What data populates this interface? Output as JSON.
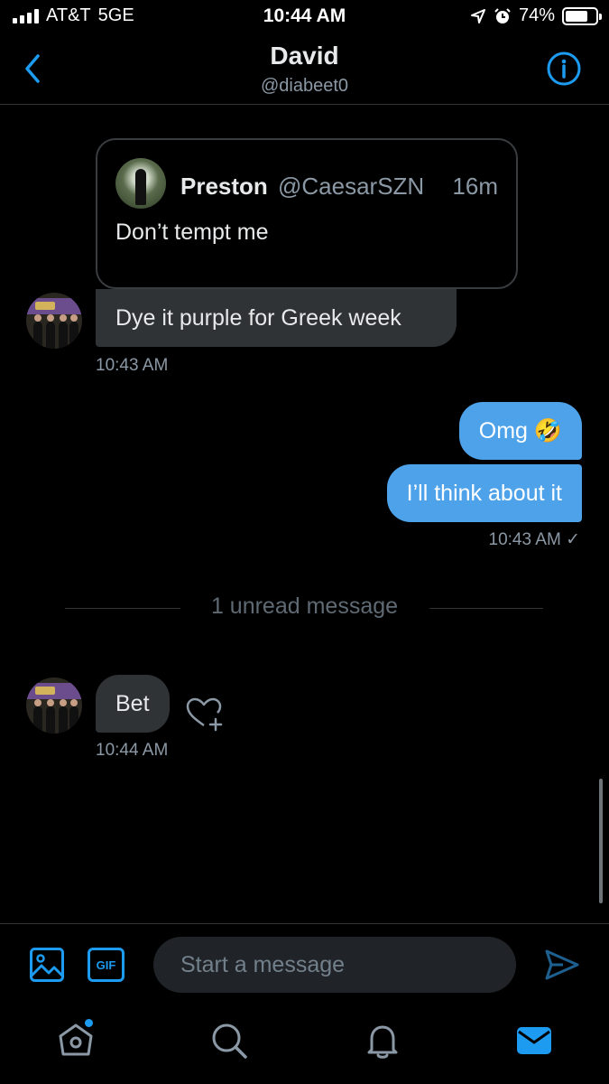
{
  "status_bar": {
    "carrier": "AT&T",
    "network": "5GE",
    "time": "10:44 AM",
    "battery": "74%",
    "battery_level": 0.74
  },
  "header": {
    "name": "David",
    "handle": "@diabeet0",
    "back_icon": "chevron-left-icon",
    "info_icon": "info-icon"
  },
  "quoted_tweet": {
    "name": "Preston",
    "handle": "@CaesarSZN",
    "time": "16m",
    "text": "Don’t tempt me"
  },
  "messages": [
    {
      "direction": "incoming",
      "text": "Dye it purple for Greek week",
      "timestamp": "10:43 AM"
    },
    {
      "direction": "outgoing",
      "text": "Omg 🤣"
    },
    {
      "direction": "outgoing",
      "text": "I’ll think about it",
      "timestamp": "10:43 AM ✓"
    },
    {
      "direction": "incoming",
      "text": "Bet",
      "timestamp": "10:44 AM"
    }
  ],
  "unread_divider": "1 unread message",
  "composer": {
    "placeholder": "Start a message",
    "gif_label": "GIF",
    "image_icon": "image-icon",
    "send_icon": "send-icon"
  },
  "tabbar": {
    "tabs": [
      "home-icon",
      "search-icon",
      "notifications-icon",
      "messages-icon"
    ],
    "active": "messages-icon"
  },
  "colors": {
    "accent": "#1d9bf0",
    "outgoing_bubble": "#4da2ea",
    "incoming_bubble": "#2f3336",
    "background": "#000000"
  }
}
